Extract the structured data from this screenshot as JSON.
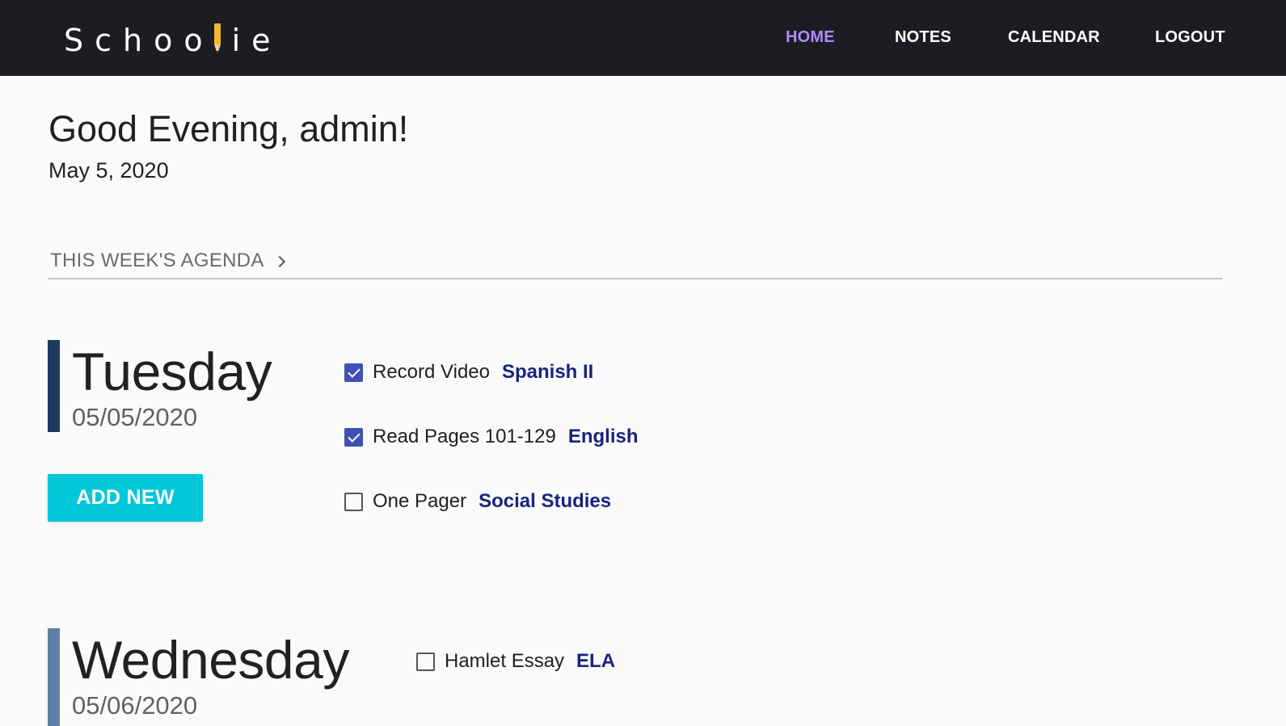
{
  "brand": {
    "logo_text_before": "Schoo",
    "logo_text_after": "ie",
    "logo_pencil_color": "#f1b730"
  },
  "nav": {
    "home": "HOME",
    "notes": "NOTES",
    "calendar": "CALENDAR",
    "logout": "LOGOUT",
    "active": "home",
    "active_color": "#b388ff",
    "background_color": "#1b1d22"
  },
  "greeting": "Good Evening, admin!",
  "date": "May 5, 2020",
  "agenda": {
    "header": "THIS WEEK'S AGENDA",
    "header_icon": "chevron-right-icon",
    "days": [
      {
        "name": "Tuesday",
        "date": "05/05/2020",
        "accent_color": "#1b3a5e",
        "add_button_label": "ADD NEW",
        "tasks": [
          {
            "name": "Record Video",
            "subject": "Spanish II",
            "checked": true
          },
          {
            "name": "Read Pages 101-129",
            "subject": "English",
            "checked": true
          },
          {
            "name": "One Pager",
            "subject": "Social Studies",
            "checked": false
          }
        ]
      },
      {
        "name": "Wednesday",
        "date": "05/06/2020",
        "accent_color": "#5b82a5",
        "tasks": [
          {
            "name": "Hamlet Essay",
            "subject": "ELA",
            "checked": false
          }
        ]
      }
    ]
  },
  "colors": {
    "add_button": "#00c8d9",
    "checkbox_checked": "#3f51b5",
    "subject_text": "#1a237e"
  }
}
